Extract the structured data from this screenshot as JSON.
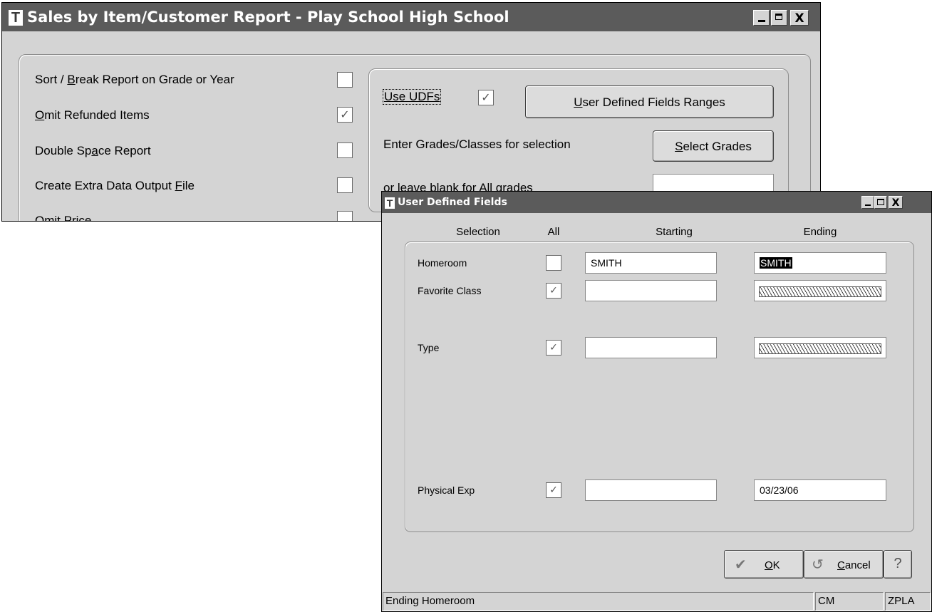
{
  "main_window": {
    "title": "Sales by Item/Customer Report - Play School High School",
    "options": [
      {
        "pre": "Sort / ",
        "key": "B",
        "post": "reak Report on Grade or Year",
        "checked": false
      },
      {
        "pre": "",
        "key": "O",
        "post": "mit Refunded Items",
        "checked": true
      },
      {
        "pre": "Double Sp",
        "key": "a",
        "post": "ce Report",
        "checked": false
      },
      {
        "pre": "Create Extra Data Output ",
        "key": "F",
        "post": "ile",
        "checked": false
      },
      {
        "pre": "",
        "key": "O",
        "post": "mit Price",
        "checked": false
      }
    ],
    "use_udfs_label": "Use UDFs",
    "use_udfs_checked": true,
    "udf_ranges_button": {
      "key": "U",
      "rest": "ser Defined Fields Ranges"
    },
    "grades_label": "Enter Grades/Classes for selection",
    "select_grades_button": {
      "key": "S",
      "rest": "elect Grades"
    },
    "blank_label": "or leave blank for All grades",
    "grades_value": ""
  },
  "dialog": {
    "title": "User Defined Fields",
    "headers": {
      "selection": "Selection",
      "all": "All",
      "starting": "Starting",
      "ending": "Ending"
    },
    "rows": [
      {
        "label": "Homeroom",
        "all": false,
        "start": "SMITH",
        "end": "SMITH",
        "end_selected": true
      },
      {
        "label": "Favorite Class",
        "all": true,
        "start": "",
        "end": "",
        "end_hatched": true
      },
      {
        "label": "Type",
        "all": true,
        "start": "",
        "end": "",
        "end_hatched": true
      },
      {
        "label": "Physical Exp",
        "all": true,
        "start": "",
        "end": "03/23/06"
      }
    ],
    "ok_button": {
      "key": "O",
      "rest": "K"
    },
    "cancel_button": {
      "key": "C",
      "rest": "ancel"
    },
    "help_button": "?",
    "status": {
      "message": "Ending Homeroom",
      "mode": "CM",
      "code": "ZPLA"
    }
  },
  "glyphs": {
    "check": "✓",
    "close": "X",
    "help": "?",
    "ok_icon": "✔",
    "cancel_icon": "↺"
  },
  "icons": [
    "app-logo-icon",
    "minimize-icon",
    "maximize-icon",
    "close-icon",
    "checkmark-icon",
    "cancel-icon",
    "help-icon"
  ]
}
